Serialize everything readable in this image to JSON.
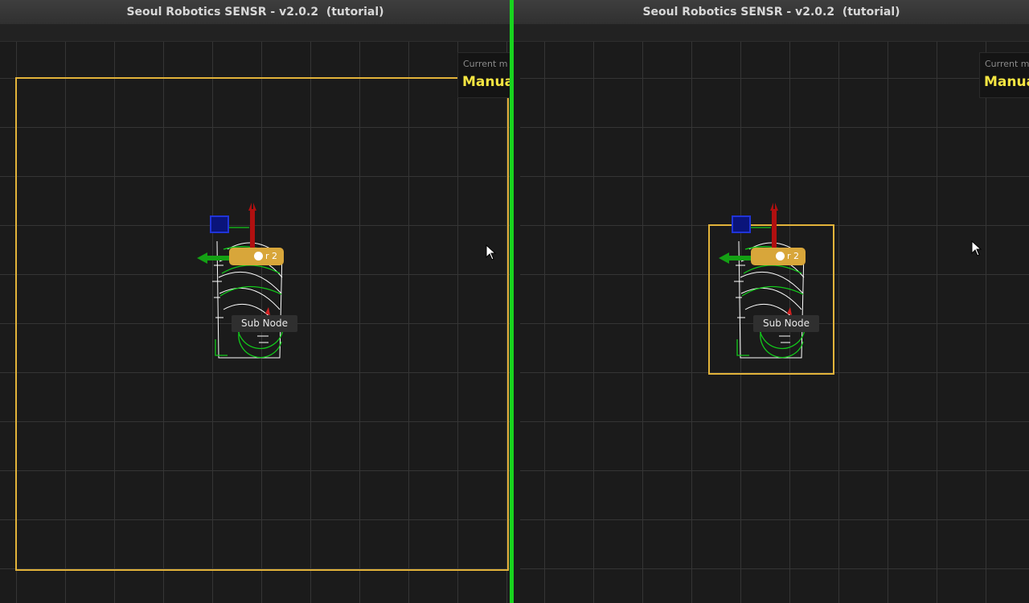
{
  "window": {
    "left": {
      "title": "Seoul Robotics SENSR - v2.0.2  (tutorial)"
    },
    "right": {
      "title": "Seoul Robotics SENSR - v2.0.2  (tutorial)"
    }
  },
  "mode_panel": {
    "caption": "Current m",
    "value": "Manua"
  },
  "scene": {
    "sensor_label": "r 2",
    "subnode_label": "Sub Node"
  },
  "colors": {
    "selection": "#e2b33a",
    "divider": "#18d41e",
    "axis_x": "#c81a1a",
    "axis_y": "#14b814",
    "mode_text": "#f4e542"
  }
}
